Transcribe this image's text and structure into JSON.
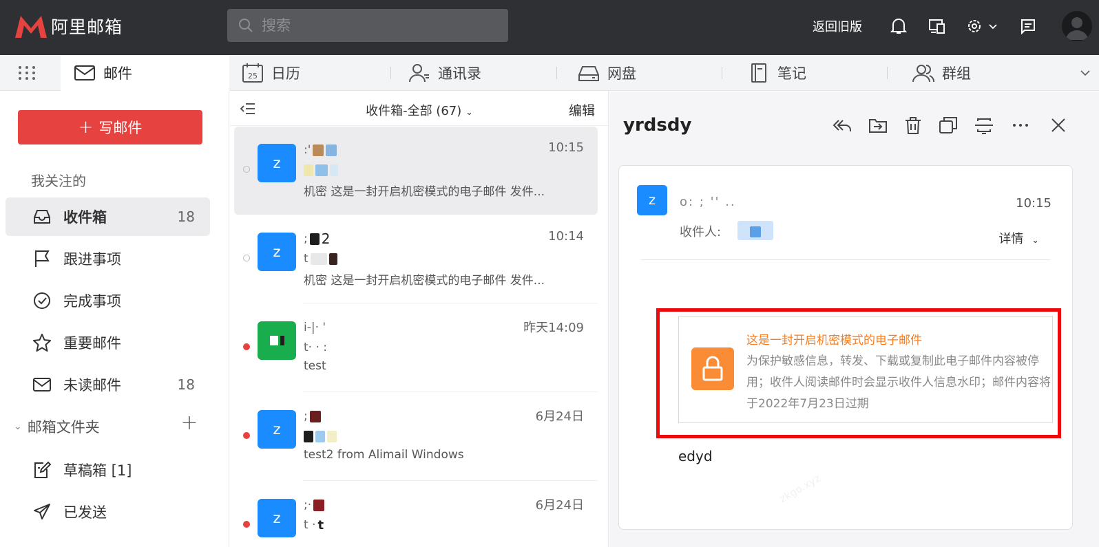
{
  "app": {
    "logo_text": "阿里邮箱",
    "brand_color": "#e64340",
    "header_bg": "#2e3033"
  },
  "header": {
    "search_placeholder": "搜索",
    "old_version_label": "返回旧版",
    "icons": [
      "search-icon",
      "bell-icon",
      "devices-icon",
      "gear-icon",
      "chevron-down-icon",
      "feedback-icon",
      "user-icon"
    ]
  },
  "module_tabs": [
    {
      "label": "邮件",
      "icon": "envelope-icon",
      "active": true
    },
    {
      "label": "日历",
      "icon": "calendar-icon",
      "calendar_day": "25"
    },
    {
      "label": "通讯录",
      "icon": "contacts-icon"
    },
    {
      "label": "网盘",
      "icon": "drive-icon"
    },
    {
      "label": "笔记",
      "icon": "notes-icon"
    },
    {
      "label": "群组",
      "icon": "group-icon"
    }
  ],
  "sidebar": {
    "compose_label": "写邮件",
    "followed_section": "我关注的",
    "items": [
      {
        "label": "收件箱",
        "count": "18",
        "icon": "inbox-icon",
        "active": true
      },
      {
        "label": "跟进事项",
        "count": "",
        "icon": "flag-icon"
      },
      {
        "label": "完成事项",
        "count": "",
        "icon": "check-circle-icon"
      },
      {
        "label": "重要邮件",
        "count": "",
        "icon": "star-icon"
      },
      {
        "label": "未读邮件",
        "count": "18",
        "icon": "envelope-icon"
      }
    ],
    "folders_section": "邮箱文件夹",
    "folders": [
      {
        "label": "草稿箱 [1]",
        "icon": "draft-icon"
      },
      {
        "label": "已发送",
        "icon": "send-icon"
      }
    ]
  },
  "message_list": {
    "folder_label": "收件箱-全部 (67)",
    "edit_label": "编辑",
    "messages": [
      {
        "avatar": "z",
        "avatar_color": "#1a8cff",
        "time": "10:15",
        "preview": "机密 这是一封开启机密模式的电子邮件 发件...",
        "unread": false,
        "selected": true
      },
      {
        "avatar": "z",
        "avatar_color": "#1a8cff",
        "time": "10:14",
        "sender_suffix": "2",
        "preview": "机密 这是一封开启机密模式的电子邮件 发件...",
        "unread": false,
        "selected": false
      },
      {
        "avatar": "",
        "avatar_color": "#1aad4e",
        "time": "昨天14:09",
        "preview": "test",
        "unread": true,
        "selected": false
      },
      {
        "avatar": "z",
        "avatar_color": "#1a8cff",
        "time": "6月24日",
        "preview": "test2 from Alimail Windows",
        "unread": true,
        "selected": false
      },
      {
        "avatar": "z",
        "avatar_color": "#1a8cff",
        "time": "6月24日",
        "subject_suffix": "t",
        "preview": "",
        "unread": true,
        "selected": false
      }
    ]
  },
  "reader": {
    "subject": "yrdsdy",
    "actions": [
      "reply-all-icon",
      "move-icon",
      "trash-icon",
      "copy-icon",
      "fold-icon",
      "more-icon",
      "close-icon"
    ],
    "avatar": "z",
    "from_partial": "o: ; '' ..",
    "time": "10:15",
    "to_label": "收件人:",
    "details_label": "详情",
    "confidential_title": "这是一封开启机密模式的电子邮件",
    "confidential_desc": "为保护敏感信息，转发、下载或复制此电子邮件内容被停用；收件人阅读邮件时会显示收件人信息水印；邮件内容将于2022年7月23日过期",
    "watermark_fragment": "zkgo.xyz",
    "body": "edyd",
    "highlight_color": "#ee0a0a"
  }
}
